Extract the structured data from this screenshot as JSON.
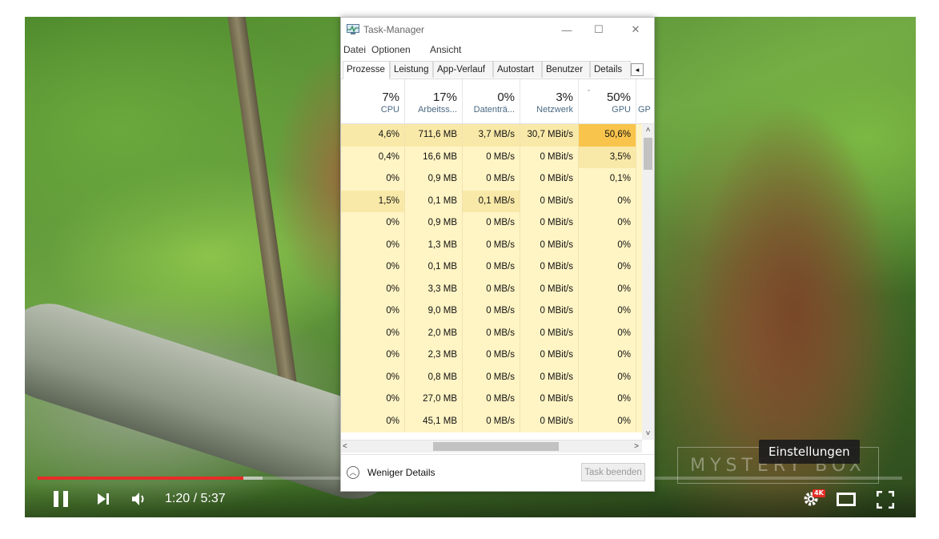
{
  "player": {
    "time": "1:20 / 5:37",
    "progress_played": 0.238,
    "progress_buffered": 0.26,
    "tooltip": "Einstellungen",
    "watermark": "MYSTERY BOX",
    "hd_badge": "4K",
    "accent_color": "#e52d27"
  },
  "taskmgr": {
    "title": "Task-Manager",
    "window_buttons": {
      "minimize": "—",
      "maximize": "☐",
      "close": "✕"
    },
    "menu": [
      "Datei",
      "Optionen",
      "Ansicht"
    ],
    "tabs": [
      "Prozesse",
      "Leistung",
      "App-Verlauf",
      "Autostart",
      "Benutzer",
      "Details"
    ],
    "active_tab": "Prozesse",
    "columns": [
      {
        "pct": "7%",
        "label": "CPU"
      },
      {
        "pct": "17%",
        "label": "Arbeitss..."
      },
      {
        "pct": "0%",
        "label": "Datenträ..."
      },
      {
        "pct": "3%",
        "label": "Netzwerk"
      },
      {
        "pct": "50%",
        "label": "GPU"
      },
      {
        "pct": "",
        "label": "GP"
      }
    ],
    "rows": [
      [
        "4,6%",
        "711,6 MB",
        "3,7 MB/s",
        "30,7 MBit/s",
        "50,6%"
      ],
      [
        "0,4%",
        "16,6 MB",
        "0 MB/s",
        "0 MBit/s",
        "3,5%"
      ],
      [
        "0%",
        "0,9 MB",
        "0 MB/s",
        "0 MBit/s",
        "0,1%"
      ],
      [
        "1,5%",
        "0,1 MB",
        "0,1 MB/s",
        "0 MBit/s",
        "0%"
      ],
      [
        "0%",
        "0,9 MB",
        "0 MB/s",
        "0 MBit/s",
        "0%"
      ],
      [
        "0%",
        "1,3 MB",
        "0 MB/s",
        "0 MBit/s",
        "0%"
      ],
      [
        "0%",
        "0,1 MB",
        "0 MB/s",
        "0 MBit/s",
        "0%"
      ],
      [
        "0%",
        "3,3 MB",
        "0 MB/s",
        "0 MBit/s",
        "0%"
      ],
      [
        "0%",
        "9,0 MB",
        "0 MB/s",
        "0 MBit/s",
        "0%"
      ],
      [
        "0%",
        "2,0 MB",
        "0 MB/s",
        "0 MBit/s",
        "0%"
      ],
      [
        "0%",
        "2,3 MB",
        "0 MB/s",
        "0 MBit/s",
        "0%"
      ],
      [
        "0%",
        "0,8 MB",
        "0 MB/s",
        "0 MBit/s",
        "0%"
      ],
      [
        "0%",
        "27,0 MB",
        "0 MB/s",
        "0 MBit/s",
        "0%"
      ],
      [
        "0%",
        "45,1 MB",
        "0 MB/s",
        "0 MBit/s",
        "0%"
      ]
    ],
    "heat_colors": {
      "low": "#fff4c4",
      "mid": "#f9e9a8",
      "high": "#f4d87a",
      "gpu_hot": "#f8c44b"
    },
    "footer": {
      "fewer_details": "Weniger Details",
      "end_task": "Task beenden"
    }
  }
}
